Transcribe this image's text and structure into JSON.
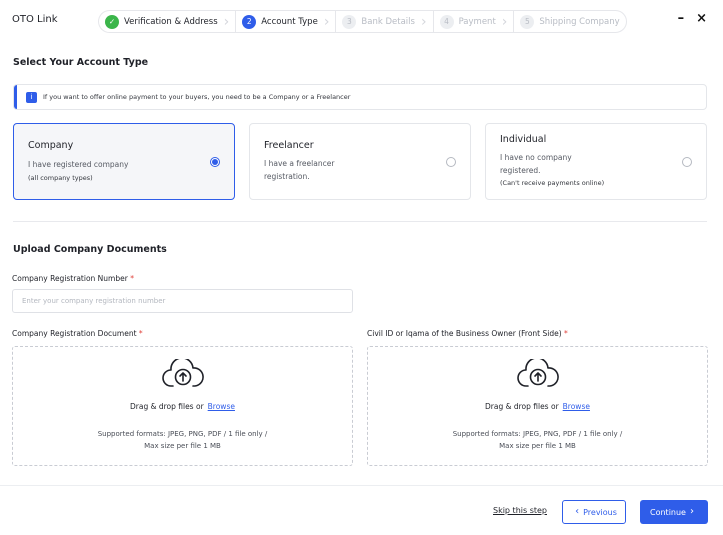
{
  "app": {
    "title": "OTO Link",
    "minimize_glyph": "–",
    "close_glyph": "×"
  },
  "stepper": {
    "steps": [
      {
        "number": "✓",
        "label": "Verification & Address",
        "state": "done"
      },
      {
        "number": "2",
        "label": "Account Type",
        "state": "active"
      },
      {
        "number": "3",
        "label": "Bank Details",
        "state": "pending"
      },
      {
        "number": "4",
        "label": "Payment",
        "state": "pending"
      },
      {
        "number": "5",
        "label": "Shipping Company",
        "state": "pending"
      }
    ]
  },
  "account_section": {
    "title": "Select Your Account Type",
    "info_icon": "info-icon",
    "info_text": "If you want to offer online payment to your buyers, you need to be a Company or a Freelancer",
    "options": [
      {
        "title": "Company",
        "description": "I have registered company",
        "subtext": "(all company types)",
        "selected": true
      },
      {
        "title": "Freelancer",
        "description_line1": "I have a freelancer",
        "description_line2": "registration.",
        "selected": false
      },
      {
        "title": "Individual",
        "description_line1": "I have no company",
        "description_line2": "registered.",
        "subtext": "(Can't receive payments online)",
        "selected": false
      }
    ]
  },
  "upload_section": {
    "title": "Upload Company Documents",
    "registration_number": {
      "label": "Company Registration Number",
      "required_mark": "*",
      "placeholder": "Enter your company registration number",
      "value": ""
    },
    "registration_document": {
      "label": "Company Registration Document",
      "required_mark": "*"
    },
    "owner_id": {
      "label": "Civil ID or Iqama of the Business Owner (Front Side)",
      "required_mark": "*"
    },
    "dropzone": {
      "drag_text": "Drag & drop files or",
      "browse_text": "Browse",
      "formats_line1": "Supported formats: JPEG, PNG, PDF / 1 file only /",
      "formats_line2": "Max size per file 1 MB",
      "icon": "cloud-upload-icon"
    }
  },
  "footer": {
    "skip_label": "Skip this step",
    "previous_label": "Previous",
    "continue_label": "Continue"
  },
  "colors": {
    "accent": "#2f5de9",
    "success": "#3bb54a",
    "required": "#e0413a"
  }
}
